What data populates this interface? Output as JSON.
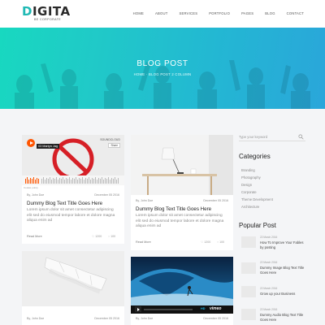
{
  "header": {
    "logo_first": "D",
    "logo_rest": "IGITA",
    "logo_tagline": "BE CORPORATE",
    "nav": [
      "HOME",
      "ABOUT",
      "SERVICES",
      "PORTFOLIO",
      "PAGES",
      "BLOG",
      "CONTACT"
    ]
  },
  "hero": {
    "title": "BLOG POST",
    "breadcrumb": "HOME · BLOG POST 2 COLUMN"
  },
  "posts": [
    {
      "meta_author": "By, John Doe",
      "meta_date": "December 05 2016",
      "title": "Dummy Blog Text Title Goes Here",
      "excerpt": "Lorem ipsum dolor sit amet consectetur adipiscing elit sed do eiusmod tempor labore et dolore magna aliqua enim ad",
      "read_more": "Read More",
      "likes": "1200",
      "comments": "100",
      "embed_label": "03 Martyn Jag",
      "embed_source": "SOUNDCLOUD",
      "embed_share": "Share",
      "embed_cookie": "Cookie policy"
    },
    {
      "meta_author": "By, John Doe",
      "meta_date": "December 05 2016",
      "title": "Dummy Blog Text Title Goes Here",
      "excerpt": "Lorem ipsum dolor sit amet consectetur adipiscing elit sed do eiusmod tempor labore et dolore magna aliqua enim ad",
      "read_more": "Read More",
      "likes": "1200",
      "comments": "100"
    },
    {
      "meta_author": "By, John Doe",
      "meta_date": "December 05 2016"
    },
    {
      "meta_author": "By, John Doe",
      "meta_date": "December 05 2016",
      "video_brand": "vimeo",
      "video_hd": "HD"
    }
  ],
  "sidebar": {
    "search_placeholder": "Type your keyword",
    "categories_heading": "Categories",
    "categories": [
      "Branding",
      "Photography",
      "Design",
      "Corporate",
      "Theme Development",
      "Architecture"
    ],
    "popular_heading": "Popular Post",
    "popular": [
      {
        "date": "22 March 2016",
        "title": "How To Improve Your Fables by posting"
      },
      {
        "date": "22 March 2016",
        "title": "Dummy Image Blog Text Title Goes Here"
      },
      {
        "date": "22 March 2016",
        "title": "Grow up your Business"
      },
      {
        "date": "22 March 2016",
        "title": "Dummy Audio Blog Text Title Goes Here"
      }
    ]
  },
  "colors": {
    "accent": "#1fb9b4",
    "hero_start": "#18d8c0",
    "hero_end": "#2aa6da",
    "soundcloud": "#ff5500",
    "vimeo": "#1ab7ea"
  }
}
